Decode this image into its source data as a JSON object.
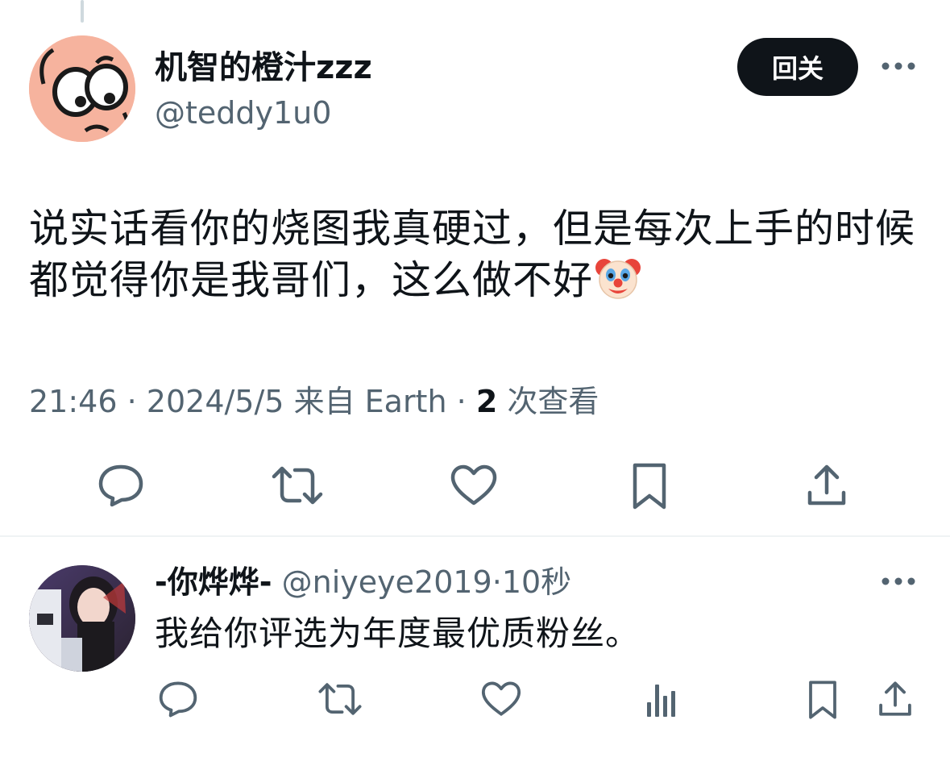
{
  "tweet": {
    "display_name": "机智的橙汁zzz",
    "handle": "@teddy1u0",
    "follow_label": "回关",
    "text": "说实话看你的烧图我真硬过，但是每次上手的时候都觉得你是我哥们，这么做不好",
    "emoji_icon": "clown-face",
    "time": "21:46",
    "date": "2024/5/5",
    "source": "来自 Earth",
    "view_count": "2",
    "view_label": "次查看",
    "separator": "·"
  },
  "reply": {
    "display_name": "-你烨烨-",
    "handle": "@niyeye2019",
    "separator": "·",
    "time": "10秒",
    "text": "我给你评选为年度最优质粉丝。"
  },
  "icons": {
    "actions_main": [
      "reply-icon",
      "retweet-icon",
      "like-icon",
      "bookmark-icon",
      "share-icon"
    ],
    "actions_reply": [
      "reply-icon",
      "retweet-icon",
      "like-icon",
      "views-icon",
      "bookmark-icon",
      "share-icon"
    ],
    "more": "more-icon"
  },
  "colors": {
    "text_primary": "#0f1419",
    "text_secondary": "#536471",
    "button_bg": "#0f1419",
    "divider": "#eff3f4"
  }
}
